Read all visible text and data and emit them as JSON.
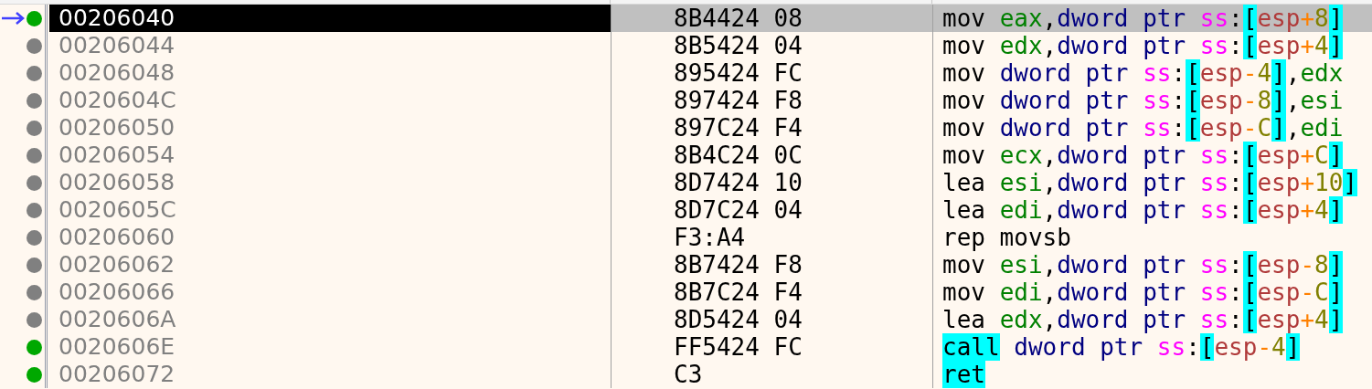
{
  "rows": [
    {
      "address": "00206040",
      "bytes": "8B4424 08",
      "selected": true,
      "current": true,
      "color": "#00a800",
      "tokens": [
        {
          "kind": "mnemonic",
          "text": "mov",
          "space_after": true
        },
        {
          "kind": "register",
          "text": "eax"
        },
        {
          "kind": "plain",
          "text": ","
        },
        {
          "kind": "size",
          "text": "dword ptr",
          "space_after": true
        },
        {
          "kind": "segment",
          "text": "ss"
        },
        {
          "kind": "plain",
          "text": ":"
        },
        {
          "kind": "bracket",
          "text": "["
        },
        {
          "kind": "base",
          "text": "esp"
        },
        {
          "kind": "operator",
          "text": "+"
        },
        {
          "kind": "number",
          "text": "8"
        },
        {
          "kind": "bracket",
          "text": "]"
        }
      ]
    },
    {
      "address": "00206044",
      "bytes": "8B5424 04",
      "selected": false,
      "current": false,
      "color": "#808080",
      "tokens": [
        {
          "kind": "mnemonic",
          "text": "mov",
          "space_after": true
        },
        {
          "kind": "register",
          "text": "edx"
        },
        {
          "kind": "plain",
          "text": ","
        },
        {
          "kind": "size",
          "text": "dword ptr",
          "space_after": true
        },
        {
          "kind": "segment",
          "text": "ss"
        },
        {
          "kind": "plain",
          "text": ":"
        },
        {
          "kind": "bracket",
          "text": "["
        },
        {
          "kind": "base",
          "text": "esp"
        },
        {
          "kind": "operator",
          "text": "+"
        },
        {
          "kind": "number",
          "text": "4"
        },
        {
          "kind": "bracket",
          "text": "]"
        }
      ]
    },
    {
      "address": "00206048",
      "bytes": "895424 FC",
      "selected": false,
      "current": false,
      "color": "#808080",
      "tokens": [
        {
          "kind": "mnemonic",
          "text": "mov",
          "space_after": true
        },
        {
          "kind": "size",
          "text": "dword ptr",
          "space_after": true
        },
        {
          "kind": "segment",
          "text": "ss"
        },
        {
          "kind": "plain",
          "text": ":"
        },
        {
          "kind": "bracket",
          "text": "["
        },
        {
          "kind": "base",
          "text": "esp"
        },
        {
          "kind": "operator",
          "text": "-"
        },
        {
          "kind": "number",
          "text": "4"
        },
        {
          "kind": "bracket",
          "text": "]"
        },
        {
          "kind": "plain",
          "text": ","
        },
        {
          "kind": "register",
          "text": "edx"
        }
      ]
    },
    {
      "address": "0020604C",
      "bytes": "897424 F8",
      "selected": false,
      "current": false,
      "color": "#808080",
      "tokens": [
        {
          "kind": "mnemonic",
          "text": "mov",
          "space_after": true
        },
        {
          "kind": "size",
          "text": "dword ptr",
          "space_after": true
        },
        {
          "kind": "segment",
          "text": "ss"
        },
        {
          "kind": "plain",
          "text": ":"
        },
        {
          "kind": "bracket",
          "text": "["
        },
        {
          "kind": "base",
          "text": "esp"
        },
        {
          "kind": "operator",
          "text": "-"
        },
        {
          "kind": "number",
          "text": "8"
        },
        {
          "kind": "bracket",
          "text": "]"
        },
        {
          "kind": "plain",
          "text": ","
        },
        {
          "kind": "register",
          "text": "esi"
        }
      ]
    },
    {
      "address": "00206050",
      "bytes": "897C24 F4",
      "selected": false,
      "current": false,
      "color": "#808080",
      "tokens": [
        {
          "kind": "mnemonic",
          "text": "mov",
          "space_after": true
        },
        {
          "kind": "size",
          "text": "dword ptr",
          "space_after": true
        },
        {
          "kind": "segment",
          "text": "ss"
        },
        {
          "kind": "plain",
          "text": ":"
        },
        {
          "kind": "bracket",
          "text": "["
        },
        {
          "kind": "base",
          "text": "esp"
        },
        {
          "kind": "operator",
          "text": "-"
        },
        {
          "kind": "number",
          "text": "C"
        },
        {
          "kind": "bracket",
          "text": "]"
        },
        {
          "kind": "plain",
          "text": ","
        },
        {
          "kind": "register",
          "text": "edi"
        }
      ]
    },
    {
      "address": "00206054",
      "bytes": "8B4C24 0C",
      "selected": false,
      "current": false,
      "color": "#808080",
      "tokens": [
        {
          "kind": "mnemonic",
          "text": "mov",
          "space_after": true
        },
        {
          "kind": "register",
          "text": "ecx"
        },
        {
          "kind": "plain",
          "text": ","
        },
        {
          "kind": "size",
          "text": "dword ptr",
          "space_after": true
        },
        {
          "kind": "segment",
          "text": "ss"
        },
        {
          "kind": "plain",
          "text": ":"
        },
        {
          "kind": "bracket",
          "text": "["
        },
        {
          "kind": "base",
          "text": "esp"
        },
        {
          "kind": "operator",
          "text": "+"
        },
        {
          "kind": "number",
          "text": "C"
        },
        {
          "kind": "bracket",
          "text": "]"
        }
      ]
    },
    {
      "address": "00206058",
      "bytes": "8D7424 10",
      "selected": false,
      "current": false,
      "color": "#808080",
      "tokens": [
        {
          "kind": "mnemonic",
          "text": "lea",
          "space_after": true
        },
        {
          "kind": "register",
          "text": "esi"
        },
        {
          "kind": "plain",
          "text": ","
        },
        {
          "kind": "size",
          "text": "dword ptr",
          "space_after": true
        },
        {
          "kind": "segment",
          "text": "ss"
        },
        {
          "kind": "plain",
          "text": ":"
        },
        {
          "kind": "bracket",
          "text": "["
        },
        {
          "kind": "base",
          "text": "esp"
        },
        {
          "kind": "operator",
          "text": "+"
        },
        {
          "kind": "number",
          "text": "10"
        },
        {
          "kind": "bracket",
          "text": "]"
        }
      ]
    },
    {
      "address": "0020605C",
      "bytes": "8D7C24 04",
      "selected": false,
      "current": false,
      "color": "#808080",
      "tokens": [
        {
          "kind": "mnemonic",
          "text": "lea",
          "space_after": true
        },
        {
          "kind": "register",
          "text": "edi"
        },
        {
          "kind": "plain",
          "text": ","
        },
        {
          "kind": "size",
          "text": "dword ptr",
          "space_after": true
        },
        {
          "kind": "segment",
          "text": "ss"
        },
        {
          "kind": "plain",
          "text": ":"
        },
        {
          "kind": "bracket",
          "text": "["
        },
        {
          "kind": "base",
          "text": "esp"
        },
        {
          "kind": "operator",
          "text": "+"
        },
        {
          "kind": "number",
          "text": "4"
        },
        {
          "kind": "bracket",
          "text": "]"
        }
      ]
    },
    {
      "address": "00206060",
      "bytes": "F3:A4",
      "selected": false,
      "current": false,
      "color": "#808080",
      "tokens": [
        {
          "kind": "mnemonic",
          "text": "rep movsb"
        }
      ]
    },
    {
      "address": "00206062",
      "bytes": "8B7424 F8",
      "selected": false,
      "current": false,
      "color": "#808080",
      "tokens": [
        {
          "kind": "mnemonic",
          "text": "mov",
          "space_after": true
        },
        {
          "kind": "register",
          "text": "esi"
        },
        {
          "kind": "plain",
          "text": ","
        },
        {
          "kind": "size",
          "text": "dword ptr",
          "space_after": true
        },
        {
          "kind": "segment",
          "text": "ss"
        },
        {
          "kind": "plain",
          "text": ":"
        },
        {
          "kind": "bracket",
          "text": "["
        },
        {
          "kind": "base",
          "text": "esp"
        },
        {
          "kind": "operator",
          "text": "-"
        },
        {
          "kind": "number",
          "text": "8"
        },
        {
          "kind": "bracket",
          "text": "]"
        }
      ]
    },
    {
      "address": "00206066",
      "bytes": "8B7C24 F4",
      "selected": false,
      "current": false,
      "color": "#808080",
      "tokens": [
        {
          "kind": "mnemonic",
          "text": "mov",
          "space_after": true
        },
        {
          "kind": "register",
          "text": "edi"
        },
        {
          "kind": "plain",
          "text": ","
        },
        {
          "kind": "size",
          "text": "dword ptr",
          "space_after": true
        },
        {
          "kind": "segment",
          "text": "ss"
        },
        {
          "kind": "plain",
          "text": ":"
        },
        {
          "kind": "bracket",
          "text": "["
        },
        {
          "kind": "base",
          "text": "esp"
        },
        {
          "kind": "operator",
          "text": "-"
        },
        {
          "kind": "number",
          "text": "C"
        },
        {
          "kind": "bracket",
          "text": "]"
        }
      ]
    },
    {
      "address": "0020606A",
      "bytes": "8D5424 04",
      "selected": false,
      "current": false,
      "color": "#808080",
      "tokens": [
        {
          "kind": "mnemonic",
          "text": "lea",
          "space_after": true
        },
        {
          "kind": "register",
          "text": "edx"
        },
        {
          "kind": "plain",
          "text": ","
        },
        {
          "kind": "size",
          "text": "dword ptr",
          "space_after": true
        },
        {
          "kind": "segment",
          "text": "ss"
        },
        {
          "kind": "plain",
          "text": ":"
        },
        {
          "kind": "bracket",
          "text": "["
        },
        {
          "kind": "base",
          "text": "esp"
        },
        {
          "kind": "operator",
          "text": "+"
        },
        {
          "kind": "number",
          "text": "4"
        },
        {
          "kind": "bracket",
          "text": "]"
        }
      ]
    },
    {
      "address": "0020606E",
      "bytes": "FF5424 FC",
      "selected": false,
      "current": false,
      "color": "#00a800",
      "tokens": [
        {
          "kind": "branch",
          "text": "call",
          "space_after": true
        },
        {
          "kind": "size",
          "text": "dword ptr",
          "space_after": true
        },
        {
          "kind": "segment",
          "text": "ss"
        },
        {
          "kind": "plain",
          "text": ":"
        },
        {
          "kind": "bracket",
          "text": "["
        },
        {
          "kind": "base",
          "text": "esp"
        },
        {
          "kind": "operator",
          "text": "-"
        },
        {
          "kind": "number",
          "text": "4"
        },
        {
          "kind": "bracket",
          "text": "]"
        }
      ]
    },
    {
      "address": "00206072",
      "bytes": "C3",
      "selected": false,
      "current": false,
      "color": "#00a800",
      "tokens": [
        {
          "kind": "branch",
          "text": "ret"
        }
      ]
    }
  ]
}
